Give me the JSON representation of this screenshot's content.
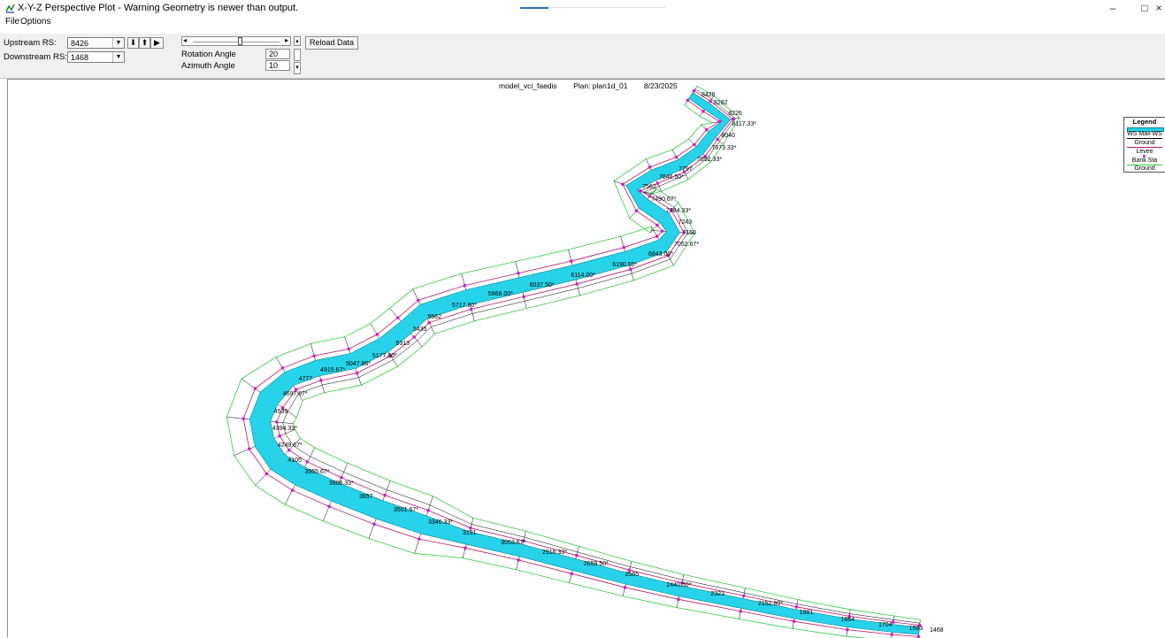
{
  "window": {
    "title": "X-Y-Z Perspective Plot - Warning Geometry is newer than output.",
    "minimize": "–",
    "maximize": "□",
    "close": "×"
  },
  "menu": [
    "File",
    "Options"
  ],
  "toolbar": {
    "upstream_label": "Upstream RS:",
    "upstream_value": "8426",
    "downstream_label": "Downstream RS:",
    "downstream_value": "1468",
    "rotation_label": "Rotation Angle",
    "rotation_value": "20",
    "azimuth_label": "Azimuth Angle",
    "azimuth_value": "10",
    "reload_label": "Reload Data",
    "down_arrow": "⬇",
    "up_arrow": "⬆",
    "play": "▶"
  },
  "plot": {
    "model": "model_vci_faedis",
    "plan": "Plan: plan1d_01",
    "date": "8/23/2025"
  },
  "legend": {
    "title": "Legend",
    "items": [
      "WS Max WS",
      "Ground",
      "Levee",
      "Bank Sta",
      "Ground"
    ]
  },
  "river_stations": [
    "8426",
    "8282",
    "8226",
    "8117.33*",
    "8040",
    "7973.33*",
    "7892.33*",
    "7797",
    "7646.50*",
    "7562",
    "7490.67*",
    "7384.33*",
    "7243",
    "7150",
    "7052.67*",
    "6843.00*",
    "6190.50*",
    "6114.00*",
    "6037.50*",
    "5868.00*",
    "5717.80*",
    "5562",
    "5435",
    "5313",
    "5177.80*",
    "5047.86*",
    "4915.67*",
    "4777",
    "4697.67*",
    "4539",
    "4394.33*",
    "4249.67*",
    "4105",
    "3955.67*",
    "3806.33*",
    "3657",
    "3501.67*",
    "3346.33*",
    "3191",
    "3053.67*",
    "2916.33*",
    "2659.50*",
    "2565",
    "2440.50*",
    "2323",
    "2152.80*",
    "1981",
    "1864",
    "1704",
    "1583",
    "1468"
  ],
  "colors": {
    "water": "#26d3ea",
    "ground": "#000000",
    "bank_station": "#d21ec8",
    "ground_boundary": "#2ecc40",
    "levee": "#b4186e"
  }
}
